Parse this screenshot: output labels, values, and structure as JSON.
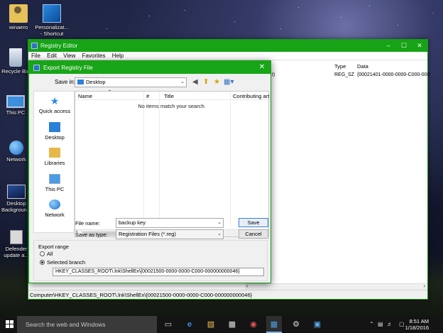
{
  "desktop": {
    "icons": [
      {
        "label": "winaero"
      },
      {
        "label": "Personalizat...\n- Shortcut"
      },
      {
        "label": "Recycle Bin"
      },
      {
        "label": "This PC"
      },
      {
        "label": "Network"
      },
      {
        "label": "Desktop Backgroun..."
      },
      {
        "label": "Defender update a..."
      }
    ]
  },
  "regedit": {
    "title": "Registry Editor",
    "menu": [
      "File",
      "Edit",
      "View",
      "Favorites",
      "Help"
    ],
    "columns": {
      "type": "Type",
      "data": "Data"
    },
    "row": {
      "name_tail": "t)",
      "type": "REG_SZ",
      "data": "{00021401-0000-0000-C000-000"
    },
    "status": "Computer\\HKEY_CLASSES_ROOT\\.lnk\\ShellEx\\{00021500-0000-0000-C000-000000000046}"
  },
  "dialog": {
    "title": "Export Registry File",
    "save_in_label": "Save in:",
    "save_in_value": "Desktop",
    "places": [
      "Quick access",
      "Desktop",
      "Libraries",
      "This PC",
      "Network"
    ],
    "columns": [
      "Name",
      "#",
      "Title",
      "Contributing art"
    ],
    "empty_text": "No items match your search.",
    "file_name_label": "File name:",
    "file_name_value": "backup key",
    "save_type_label": "Save as type:",
    "save_type_value": "Registration Files (*.reg)",
    "save_button": "Save",
    "cancel_button": "Cancel",
    "export_range_label": "Export range",
    "opt_all": "All",
    "opt_branch": "Selected branch",
    "branch_value": "HKEY_CLASSES_ROOT\\.lnk\\ShellEx\\{00021500-0000-0000-C000-000000000046}"
  },
  "taskbar": {
    "search_placeholder": "Search the web and Windows",
    "time": "8:51 AM",
    "date": "1/18/2016"
  }
}
